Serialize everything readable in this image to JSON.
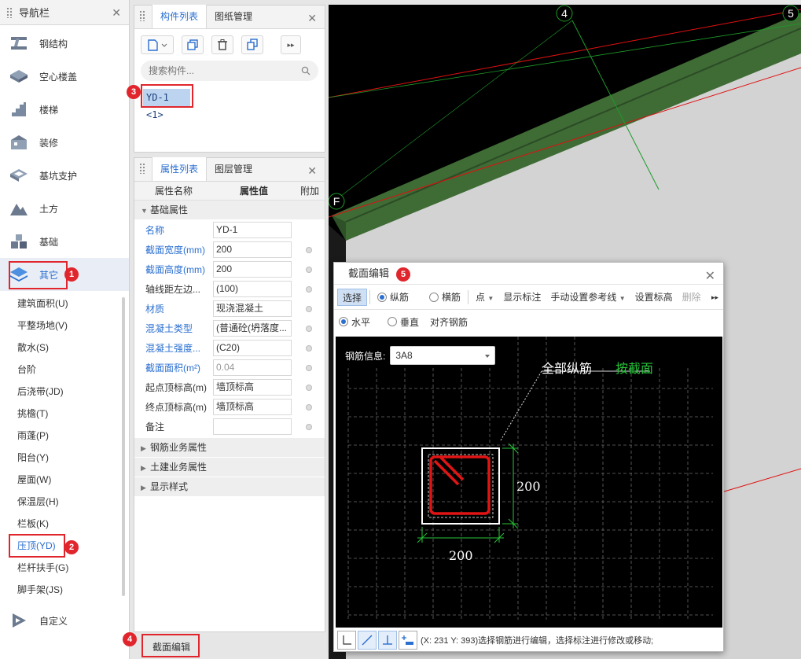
{
  "nav": {
    "title": "导航栏",
    "items": [
      {
        "label": "钢结构",
        "icon": "steel-structure-icon"
      },
      {
        "label": "空心楼盖",
        "icon": "hollow-floor-icon"
      },
      {
        "label": "楼梯",
        "icon": "stairs-icon"
      },
      {
        "label": "装修",
        "icon": "decoration-icon"
      },
      {
        "label": "基坑支护",
        "icon": "pit-support-icon"
      },
      {
        "label": "土方",
        "icon": "earthwork-icon"
      },
      {
        "label": "基础",
        "icon": "foundation-icon"
      },
      {
        "label": "其它",
        "icon": "layers-icon"
      }
    ],
    "sub_items": [
      "建筑面积(U)",
      "平整场地(V)",
      "散水(S)",
      "台阶",
      "后浇带(JD)",
      "挑檐(T)",
      "雨蓬(P)",
      "阳台(Y)",
      "屋面(W)",
      "保温层(H)",
      "栏板(K)",
      "压顶(YD)",
      "栏杆扶手(G)",
      "脚手架(JS)"
    ],
    "custom": "自定义"
  },
  "component_list": {
    "tabs": [
      "构件列表",
      "图纸管理"
    ],
    "search_placeholder": "搜索构件...",
    "item": "YD-1 <1>"
  },
  "properties": {
    "tabs": [
      "属性列表",
      "图层管理"
    ],
    "headers": [
      "属性名称",
      "属性值",
      "附加"
    ],
    "section_basic": "基础属性",
    "rows": [
      {
        "name": "名称",
        "value": "YD-1"
      },
      {
        "name": "截面宽度(mm)",
        "value": "200"
      },
      {
        "name": "截面高度(mm)",
        "value": "200"
      },
      {
        "name": "轴线距左边...",
        "value": "(100)"
      },
      {
        "name": "材质",
        "value": "现浇混凝土"
      },
      {
        "name": "混凝土类型",
        "value": "(普通砼(坍落度..."
      },
      {
        "name": "混凝土强度...",
        "value": "(C20)"
      },
      {
        "name": "截面面积(m²)",
        "value": "0.04"
      },
      {
        "name": "起点顶标高(m)",
        "value": "墙顶标高"
      },
      {
        "name": "终点顶标高(m)",
        "value": "墙顶标高"
      },
      {
        "name": "备注",
        "value": ""
      }
    ],
    "sections_collapsed": [
      "钢筋业务属性",
      "土建业务属性",
      "显示样式"
    ]
  },
  "bottom_button": "截面编辑",
  "viewport": {
    "axis_labels": [
      "4",
      "5",
      "F"
    ]
  },
  "dialog": {
    "title": "截面编辑",
    "toolbar": {
      "select": "选择",
      "longitudinal": "纵筋",
      "stirrup": "横筋",
      "point": "点",
      "show_dim": "显示标注",
      "manual_ref": "手动设置参考线",
      "set_elev": "设置标高",
      "delete": "删除"
    },
    "toolbar2": {
      "horizontal": "水平",
      "vertical": "垂直",
      "align": "对齐钢筋"
    },
    "rebar_info_label": "钢筋信息:",
    "rebar_info_value": "3A8",
    "annotation_all": "全部纵筋",
    "annotation_by": "按截面",
    "dim_h": "200",
    "dim_w": "200",
    "status_text": "(X: 231 Y: 393)选择钢筋进行编辑，选择标注进行修改或移动;"
  },
  "badges": [
    "1",
    "2",
    "3",
    "4",
    "5"
  ],
  "colors": {
    "accent_blue": "#2a6fd0",
    "highlight_red": "#e0262c",
    "dim_green": "#27c43a"
  }
}
